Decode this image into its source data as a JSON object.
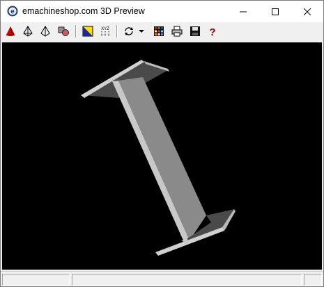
{
  "window": {
    "title": "emachineshop.com 3D Preview",
    "app_icon": "emachineshop-logo-icon",
    "caption_buttons": [
      {
        "name": "minimize-button",
        "glyph": "—",
        "icon": "minimize-icon"
      },
      {
        "name": "maximize-button",
        "glyph": "☐",
        "icon": "maximize-icon"
      },
      {
        "name": "close-button",
        "glyph": "✕",
        "icon": "close-icon"
      }
    ]
  },
  "toolbar": {
    "buttons": [
      {
        "name": "shaded-view-button",
        "icon": "red-cone-icon"
      },
      {
        "name": "wireframe-view-button",
        "icon": "wireframe-pyramid-icon"
      },
      {
        "name": "hidden-line-view-button",
        "icon": "outline-pyramid-icon"
      },
      {
        "name": "materials-button",
        "icon": "shapes-icon"
      },
      {
        "name": "background-color-button",
        "icon": "color-square-icon"
      },
      {
        "name": "axes-button",
        "icon": "xyz-axes-icon"
      },
      {
        "name": "rotate-button",
        "icon": "rotate-arrows-icon"
      },
      {
        "name": "rotate-dropdown-button",
        "icon": "dropdown-arrow-icon"
      },
      {
        "name": "palette-button",
        "icon": "color-grid-icon"
      },
      {
        "name": "print-button",
        "icon": "printer-icon"
      },
      {
        "name": "save-button",
        "icon": "floppy-disk-icon"
      },
      {
        "name": "help-button",
        "icon": "question-mark-icon"
      }
    ]
  },
  "viewport": {
    "background": "#000000",
    "model": "i-beam-3d-model",
    "face_colors": {
      "web_front": "#8c8c8c",
      "web_edge": "#c8c8c8",
      "flange_top": "#4a4a4a",
      "flange_edge": "#cfcfcf"
    }
  },
  "statusbar": {
    "panes": [
      "",
      "",
      ""
    ]
  }
}
